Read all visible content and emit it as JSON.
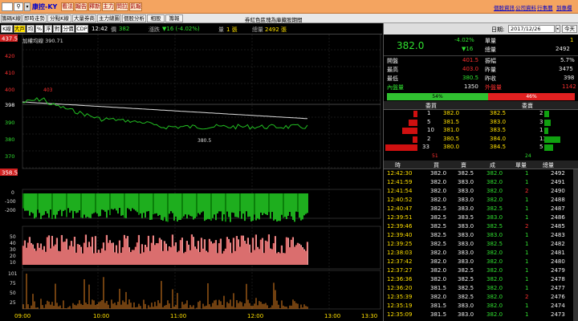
{
  "topbar": {
    "stock_name": "康控-KY",
    "buttons": [
      "看法",
      "報告",
      "釋新",
      "主力",
      "問拉",
      "氣報"
    ],
    "links": [
      "個股資訊",
      "公司資料",
      "行事曆",
      "到專欄"
    ]
  },
  "tabs": [
    "籌碼K線",
    "即時走勢",
    "分點K線",
    "大量券商",
    "主力總圖",
    "個股分析",
    "相股",
    "籌報"
  ],
  "notice": "券紅色區塊為庫藏股期間",
  "control": {
    "buttons": [
      "K線",
      "大戶",
      "均",
      "%",
      "浮",
      "對",
      "分價",
      "CDP"
    ],
    "time": "12:42",
    "price_label": "價",
    "price": "382",
    "change_label": "漲跌",
    "change": "▼16 (-4.02%)",
    "vol_label": "量",
    "vol": "1 張",
    "total_label": "總量",
    "total": "2492 張"
  },
  "chart_labels": {
    "avg_line": "加權均線 390.71",
    "high_tag": "437.5",
    "low_tag": "358.5",
    "max_mark": "403",
    "min_mark": "380.5"
  },
  "price_axis": [
    "420",
    "410",
    "400",
    "398",
    "390",
    "380",
    "370"
  ],
  "flow_axis": [
    "0",
    "-100",
    "-200"
  ],
  "ratio_axis": [
    "50",
    "40",
    "30",
    "20",
    "10"
  ],
  "vol_axis": [
    "101",
    "75",
    "50",
    "25"
  ],
  "time_axis": [
    "09:00",
    "10:00",
    "11:00",
    "12:00",
    "13:00",
    "13:30"
  ],
  "date": {
    "label": "日期:",
    "value": "2017/12/26",
    "today": "今天"
  },
  "quote": {
    "price": "382.0",
    "pct": "-4.02%",
    "chg": "▼16",
    "unit_label": "單量",
    "unit": "1",
    "total_label": "總量",
    "total": "2492"
  },
  "stats": [
    {
      "k": "開盤",
      "v": "401.5",
      "k2": "振幅",
      "v2": "5.7%"
    },
    {
      "k": "最高",
      "v": "403.0",
      "k2": "昨量",
      "v2": "3475"
    },
    {
      "k": "最低",
      "v": "380.5",
      "k2": "昨收",
      "v2": "398"
    }
  ],
  "inout": {
    "in_label": "內盤量",
    "in": "1350",
    "out_label": "外盤量",
    "out": "1142",
    "in_pct": "54%",
    "out_pct": "46%"
  },
  "book_headers": [
    "委買",
    "委賣"
  ],
  "book": [
    {
      "bq": "1",
      "bp": "382.0",
      "ap": "382.5",
      "aq": "2"
    },
    {
      "bq": "5",
      "bp": "381.5",
      "ap": "383.0",
      "aq": "3"
    },
    {
      "bq": "10",
      "bp": "381.0",
      "ap": "383.5",
      "aq": "1"
    },
    {
      "bq": "2",
      "bp": "380.5",
      "ap": "384.0",
      "aq": "13"
    },
    {
      "bq": "33",
      "bp": "380.0",
      "ap": "384.5",
      "aq": "5"
    }
  ],
  "book_totals": {
    "bid": "51",
    "ask": "24"
  },
  "ticks_headers": [
    "時",
    "買",
    "賣",
    "成",
    "單量",
    "總量"
  ],
  "ticks": [
    [
      "12:42:30",
      "382.0",
      "382.5",
      "382.0",
      "1",
      "2492"
    ],
    [
      "12:41:59",
      "382.0",
      "383.0",
      "382.0",
      "1",
      "2491"
    ],
    [
      "12:41:54",
      "382.0",
      "383.0",
      "382.0",
      "2",
      "2490"
    ],
    [
      "12:40:52",
      "382.0",
      "383.0",
      "382.0",
      "1",
      "2488"
    ],
    [
      "12:40:47",
      "382.5",
      "383.0",
      "382.5",
      "1",
      "2487"
    ],
    [
      "12:39:51",
      "382.5",
      "383.5",
      "383.0",
      "1",
      "2486"
    ],
    [
      "12:39:46",
      "382.5",
      "383.0",
      "382.5",
      "2",
      "2485"
    ],
    [
      "12:39:40",
      "382.5",
      "383.0",
      "383.0",
      "1",
      "2483"
    ],
    [
      "12:39:25",
      "382.5",
      "383.0",
      "382.5",
      "1",
      "2482"
    ],
    [
      "12:38:03",
      "382.0",
      "383.0",
      "382.0",
      "1",
      "2481"
    ],
    [
      "12:37:42",
      "382.0",
      "383.0",
      "382.0",
      "1",
      "2480"
    ],
    [
      "12:37:27",
      "382.0",
      "382.5",
      "382.0",
      "1",
      "2479"
    ],
    [
      "12:36:36",
      "382.0",
      "382.5",
      "382.0",
      "1",
      "2478"
    ],
    [
      "12:36:20",
      "381.5",
      "382.5",
      "382.0",
      "1",
      "2477"
    ],
    [
      "12:35:39",
      "382.0",
      "382.5",
      "382.0",
      "2",
      "2476"
    ],
    [
      "12:35:19",
      "381.5",
      "383.0",
      "382.0",
      "1",
      "2474"
    ],
    [
      "12:35:09",
      "381.5",
      "383.0",
      "382.0",
      "1",
      "2473"
    ]
  ],
  "colors": {
    "up": "#ff3030",
    "down": "#30e030",
    "neutral": "#ffe000",
    "accent": "#f4a460"
  }
}
